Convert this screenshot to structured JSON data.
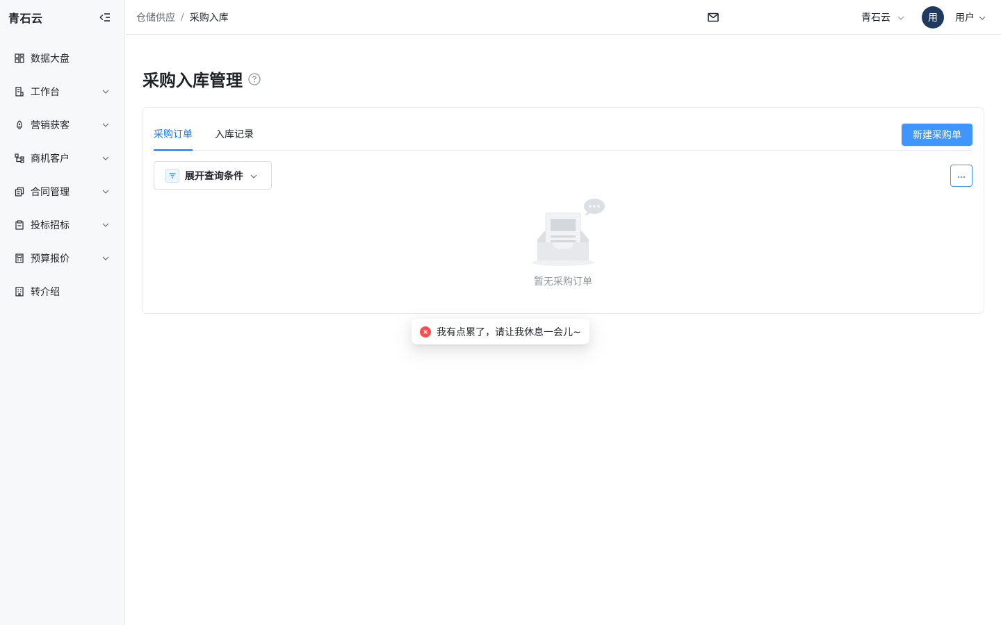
{
  "app": {
    "brand": "青石云"
  },
  "sidebar": {
    "items": [
      {
        "label": "数据大盘",
        "icon": "dashboard-icon",
        "expandable": false
      },
      {
        "label": "工作台",
        "icon": "workbench-icon",
        "expandable": true
      },
      {
        "label": "营销获客",
        "icon": "rocket-icon",
        "expandable": true
      },
      {
        "label": "商机客户",
        "icon": "customer-tree-icon",
        "expandable": true
      },
      {
        "label": "合同管理",
        "icon": "contract-icon",
        "expandable": true
      },
      {
        "label": "投标招标",
        "icon": "clipboard-icon",
        "expandable": true
      },
      {
        "label": "预算报价",
        "icon": "calculator-icon",
        "expandable": true
      },
      {
        "label": "转介绍",
        "icon": "building-icon",
        "expandable": false
      }
    ]
  },
  "header": {
    "breadcrumb": {
      "parent": "仓储供应",
      "separator": "/",
      "current": "采购入库"
    },
    "org": "青石云",
    "avatar_text": "用",
    "user": "用户"
  },
  "main": {
    "title": "采购入库管理",
    "tabs": [
      {
        "label": "采购订单",
        "active": true
      },
      {
        "label": "入库记录",
        "active": false
      }
    ],
    "new_button": "新建采购单",
    "filter_label": "展开查询条件",
    "empty_text": "暂无采购订单"
  },
  "toast": {
    "type": "error",
    "text": "我有点累了，请让我休息一会儿~"
  },
  "colors": {
    "accent": "#1677ff",
    "button": "#4096ff",
    "error": "#ff4d4f",
    "avatar": "#1f3a5f"
  }
}
